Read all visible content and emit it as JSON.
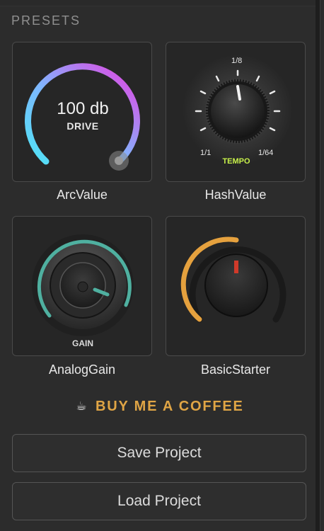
{
  "section": {
    "title": "PRESETS"
  },
  "presets": [
    {
      "name": "ArcValue",
      "knob": {
        "value_text": "100 db",
        "param_text": "DRIVE"
      }
    },
    {
      "name": "HashValue",
      "knob": {
        "top_label": "1/8",
        "left_label": "1/1",
        "right_label": "1/64",
        "caption": "TEMPO"
      }
    },
    {
      "name": "AnalogGain",
      "knob": {
        "caption": "GAIN"
      }
    },
    {
      "name": "BasicStarter",
      "knob": {}
    }
  ],
  "coffee": {
    "icon": "coffee-cup-icon",
    "glyph": "☕",
    "label": "BUY ME A COFFEE",
    "color": "#e0a545"
  },
  "buttons": {
    "save": "Save Project",
    "load": "Load Project"
  },
  "colors": {
    "arc_gradient": [
      "#5ad0f0",
      "#e040e0"
    ],
    "tempo_caption": "#c7f04a",
    "gain_ring": "#4fb0a0",
    "starter_ring": "#e5a13e",
    "starter_pointer": "#d03a2a"
  }
}
